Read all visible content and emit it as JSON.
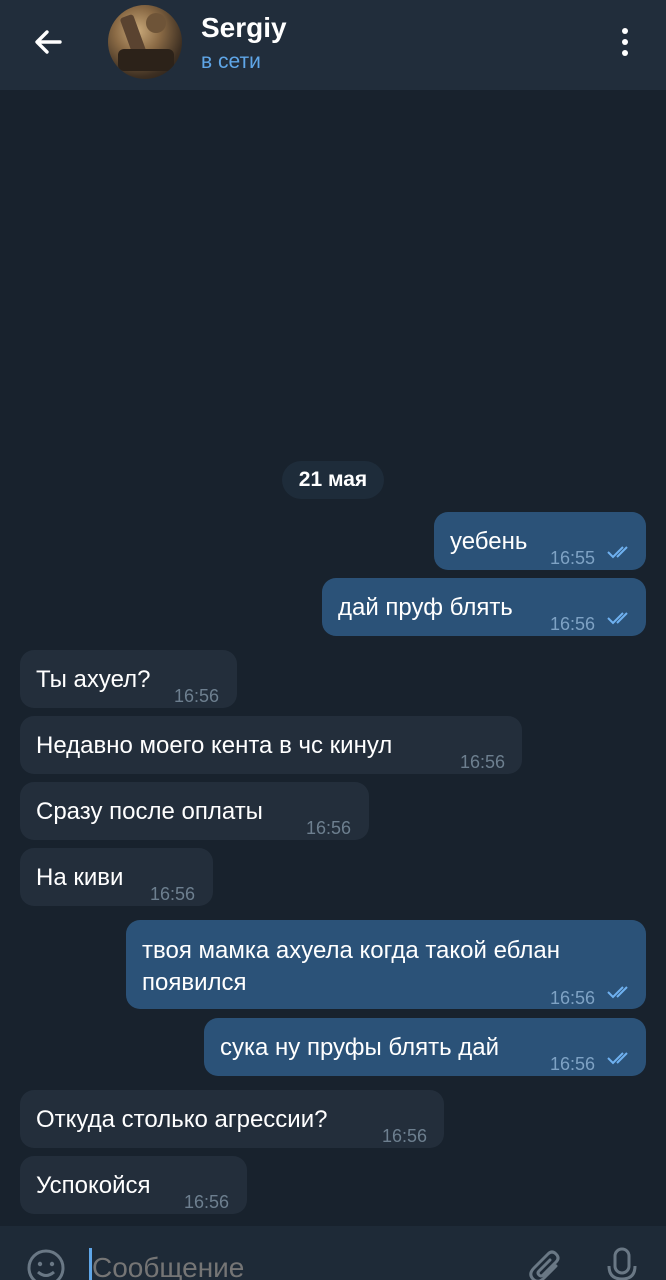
{
  "header": {
    "name": "Sergiy",
    "status": "в сети"
  },
  "date_divider": "21 мая",
  "messages": [
    {
      "dir": "out",
      "text": "уебень",
      "time": "16:55",
      "read": true
    },
    {
      "dir": "out",
      "text": "дай пруф блять",
      "time": "16:56",
      "read": true
    },
    {
      "dir": "in",
      "text": "Ты ахуел?",
      "time": "16:56"
    },
    {
      "dir": "in",
      "text": "Недавно моего кента в чс кинул",
      "time": "16:56"
    },
    {
      "dir": "in",
      "text": "Сразу после оплаты",
      "time": "16:56"
    },
    {
      "dir": "in",
      "text": "На киви",
      "time": "16:56"
    },
    {
      "dir": "out",
      "text_line1": "твоя мамка ахуела когда такой еблан",
      "text_line2": "появился",
      "time": "16:56",
      "read": true
    },
    {
      "dir": "out",
      "text": "сука ну пруфы блять дай",
      "time": "16:56",
      "read": true
    },
    {
      "dir": "in",
      "text": "Откуда столько агрессии?",
      "time": "16:56"
    },
    {
      "dir": "in",
      "text": "Успокойся",
      "time": "16:56"
    }
  ],
  "composer": {
    "placeholder": "Сообщение"
  },
  "colors": {
    "background": "#18222d",
    "header": "#212d3b",
    "outgoing_bubble": "#2b5278",
    "incoming_bubble": "#232e3b",
    "accent": "#5fa6e8"
  }
}
